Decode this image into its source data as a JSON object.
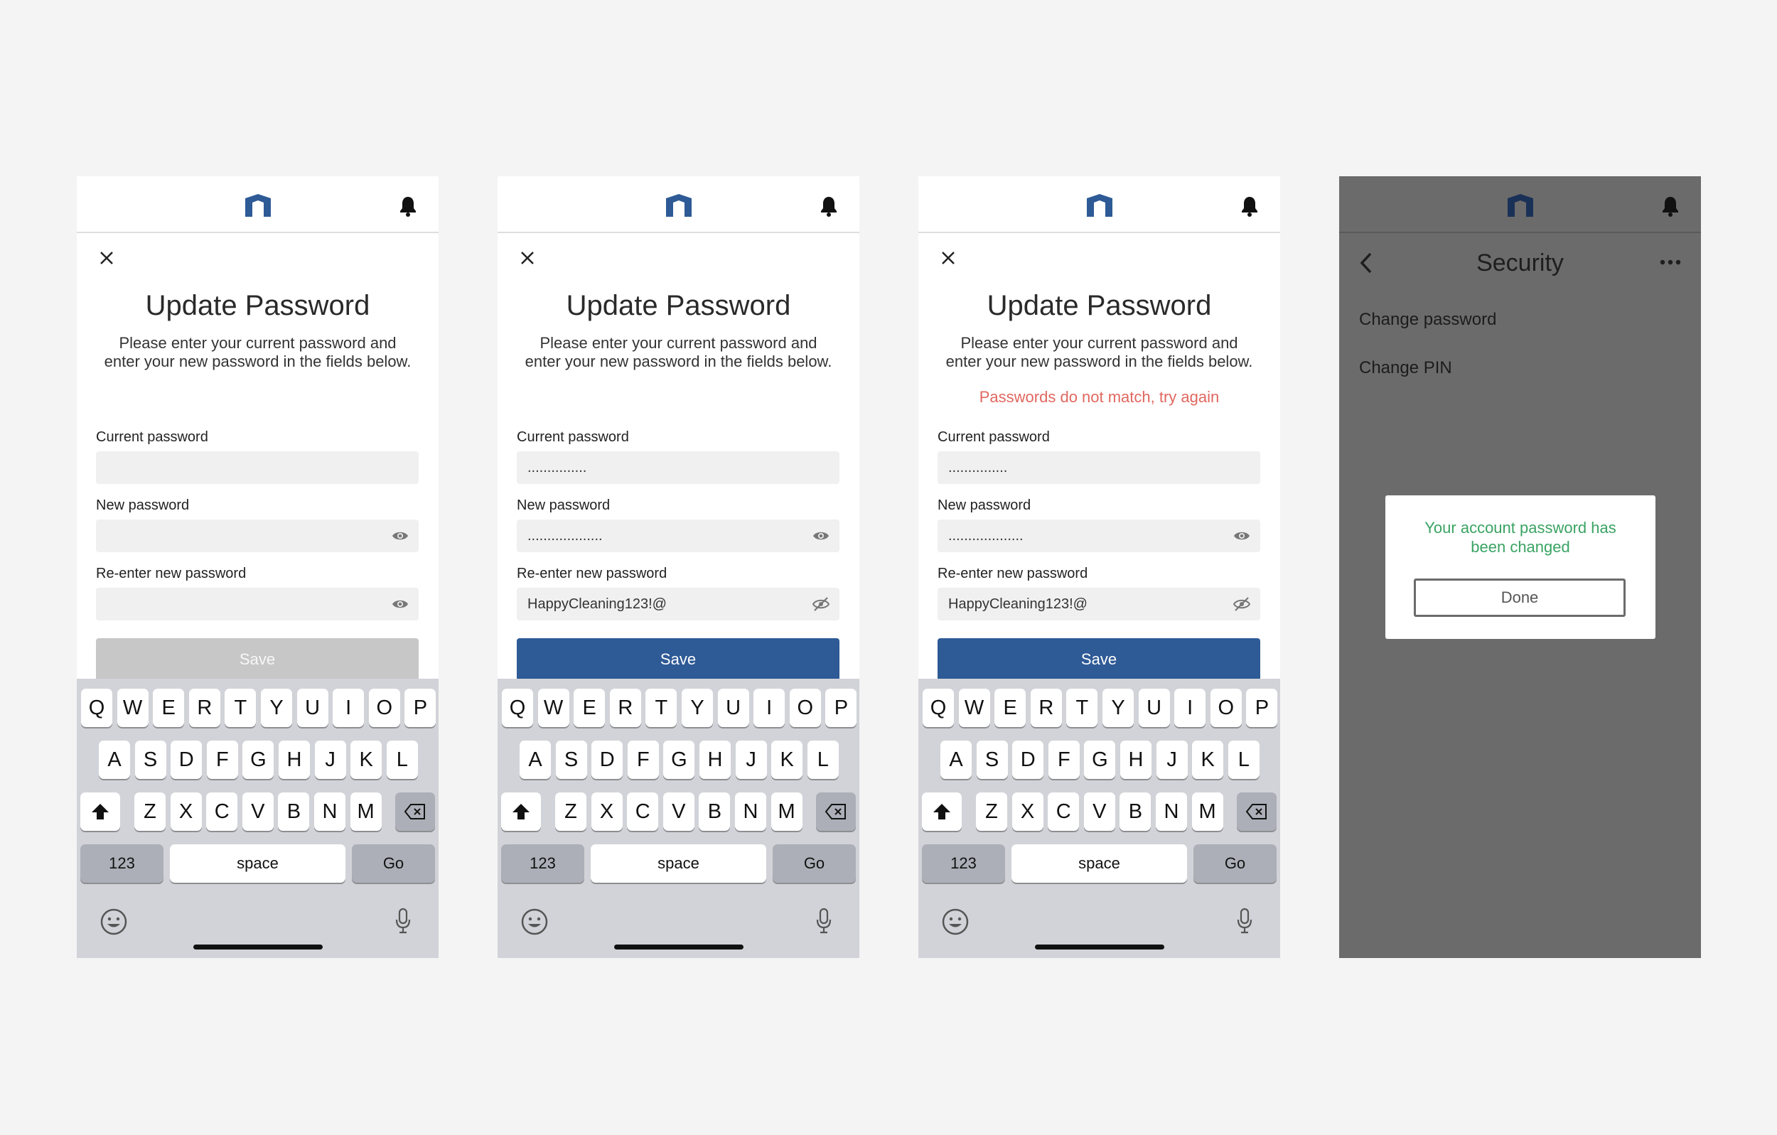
{
  "screens": [
    {
      "title": "Update Password",
      "subtitle_line1": "Please enter your current password and",
      "subtitle_line2": "enter your new password in the fields below.",
      "error": "",
      "fields": [
        {
          "label": "Current password",
          "value": ""
        },
        {
          "label": "New password",
          "value": ""
        },
        {
          "label": "Re-enter new password",
          "value": ""
        }
      ],
      "save_label": "Save",
      "save_enabled": false
    },
    {
      "title": "Update Password",
      "subtitle_line1": "Please enter your current password and",
      "subtitle_line2": "enter your new password in the fields below.",
      "error": "",
      "fields": [
        {
          "label": "Current password",
          "value": "..............."
        },
        {
          "label": "New password",
          "value": "..................."
        },
        {
          "label": "Re-enter new password",
          "value": "HappyCleaning123!@"
        }
      ],
      "save_label": "Save",
      "save_enabled": true
    },
    {
      "title": "Update Password",
      "subtitle_line1": "Please enter your current password and",
      "subtitle_line2": "enter your new password in the fields below.",
      "error": "Passwords do not match, try again",
      "fields": [
        {
          "label": "Current password",
          "value": "..............."
        },
        {
          "label": "New password",
          "value": "..................."
        },
        {
          "label": "Re-enter new password",
          "value": "HappyCleaning123!@"
        }
      ],
      "save_label": "Save",
      "save_enabled": true
    }
  ],
  "keyboard": {
    "row1": [
      "Q",
      "W",
      "E",
      "R",
      "T",
      "Y",
      "U",
      "I",
      "O",
      "P"
    ],
    "row2": [
      "A",
      "S",
      "D",
      "F",
      "G",
      "H",
      "J",
      "K",
      "L"
    ],
    "row3": [
      "Z",
      "X",
      "C",
      "V",
      "B",
      "N",
      "M"
    ],
    "numbers_label": "123",
    "space_label": "space",
    "go_label": "Go",
    "icons": {
      "shift": "shift-icon",
      "delete": "backspace-icon",
      "emoji": "emoji-icon",
      "mic": "microphone-icon"
    }
  },
  "security": {
    "title": "Security",
    "items": [
      "Change password",
      "Change PIN"
    ],
    "modal": {
      "message_line1": "Your account password has",
      "message_line2": "been changed",
      "done_label": "Done"
    }
  },
  "icons": {
    "logo": "app-logo-icon",
    "bell": "bell-icon",
    "close": "close-icon",
    "eye": "eye-icon",
    "eye_off": "eye-off-icon",
    "back": "chevron-left-icon",
    "more": "more-icon"
  },
  "colors": {
    "brand": "#2e5a96",
    "error": "#e0675f",
    "success": "#3aa363",
    "disabled": "#c7c7c7",
    "overlay": "#6b6b6b"
  }
}
